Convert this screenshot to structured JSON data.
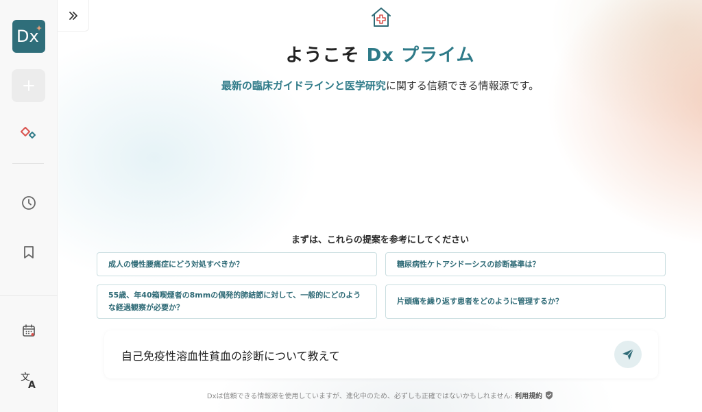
{
  "sidebar": {
    "logo_text": "Dx",
    "icons": [
      "plus-icon",
      "sparkle-diamond-icon",
      "clock-icon",
      "bookmark-icon",
      "calendar-icon",
      "translate-icon"
    ]
  },
  "colors": {
    "brand": "#2e7a88",
    "accent_red": "#d9534f",
    "logo_bg": "#2f6e7a"
  },
  "hero": {
    "title_prefix": "ようこそ ",
    "title_brand": "Dx プライム",
    "subtitle_hl": "最新の臨床ガイドラインと医学研究",
    "subtitle_rest": "に関する信頼できる情報源です。"
  },
  "suggestions": {
    "heading": "まずは、これらの提案を参考にしてください",
    "items": [
      "成人の慢性腰痛症にどう対処すべきか？",
      "糖尿病性ケトアシドーシスの診断基準は？",
      "55歳、年40箱喫煙者の8mmの偶発的肺結節に対して、一般的にどのような経過観察が必要か？",
      "片頭痛を繰り返す患者をどのように管理するか？"
    ]
  },
  "input": {
    "value": "自己免疫性溶血性貧血の診断について教えて"
  },
  "footer": {
    "disclaimer": "Dxは信頼できる情報源を使用していますが、進化中のため、必ずしも正確ではないかもしれません: ",
    "terms_label": "利用規約"
  }
}
